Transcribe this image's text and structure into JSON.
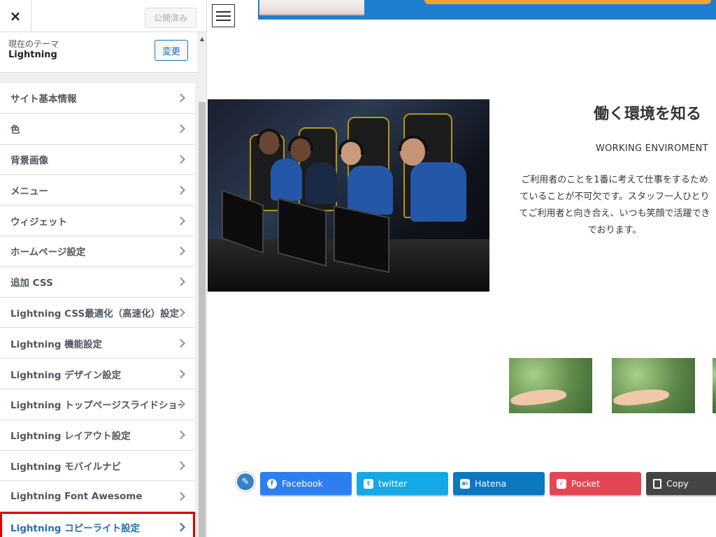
{
  "sidebar": {
    "close_icon": "×",
    "published_label": "公開済み",
    "theme_label": "現在のテーマ",
    "theme_name": "Lightning",
    "change_label": "変更",
    "items": [
      {
        "label": "サイト基本情報"
      },
      {
        "label": "色"
      },
      {
        "label": "背景画像"
      },
      {
        "label": "メニュー"
      },
      {
        "label": "ウィジェット"
      },
      {
        "label": "ホームページ設定"
      },
      {
        "label": "追加 CSS"
      },
      {
        "label": "Lightning CSS最適化（高速化）設定"
      },
      {
        "label": "Lightning 機能設定"
      },
      {
        "label": "Lightning デザイン設定"
      },
      {
        "label": "Lightning トップページスライドショー"
      },
      {
        "label": "Lightning レイアウト設定"
      },
      {
        "label": "Lightning モバイルナビ"
      },
      {
        "label": "Lightning Font Awesome"
      },
      {
        "label": "Lightning コピーライト設定"
      }
    ]
  },
  "preview": {
    "heading": "働く環境を知る",
    "subheading": "WORKING ENVIROMENT",
    "description_lines": [
      "ご利用者のことを1番に考えて仕事をするため",
      "ていることが不可欠です。スタッフ一人ひとり",
      "てご利用者と向き合え、いつも笑顔で活躍でき",
      "でおります。"
    ],
    "share": {
      "facebook": "Facebook",
      "twitter": "twitter",
      "hatena": "Hatena",
      "pocket": "Pocket",
      "copy": "Copy"
    }
  },
  "colors": {
    "accent": "#2271b1",
    "highlight_border": "#e00000",
    "facebook": "#2d7ef0",
    "twitter": "#14a8e6",
    "hatena": "#0b78c0",
    "pocket": "#e44653",
    "copy": "#444444"
  }
}
